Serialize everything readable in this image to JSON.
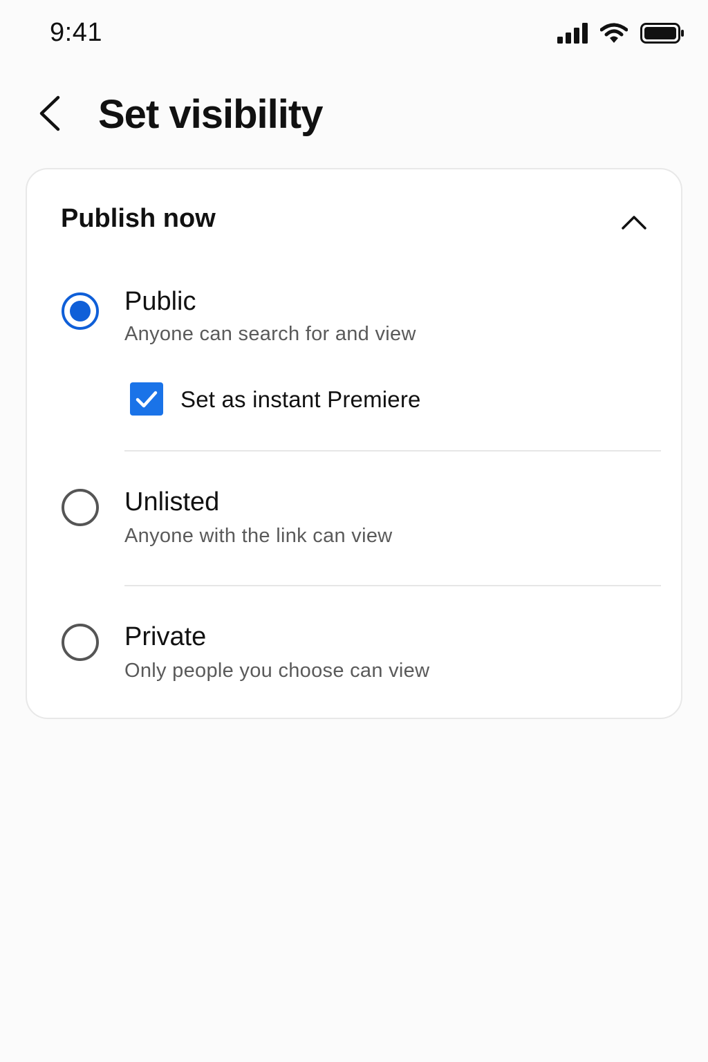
{
  "status_bar": {
    "time": "9:41",
    "icons": [
      "signal-icon",
      "wifi-icon",
      "battery-icon"
    ]
  },
  "header": {
    "back_icon": "chevron-left-icon",
    "title": "Set visibility"
  },
  "card": {
    "title": "Publish now",
    "collapse_icon": "chevron-up-icon",
    "options": [
      {
        "label": "Public",
        "description": "Anyone can search for and view",
        "selected": true
      },
      {
        "label": "Unlisted",
        "description": "Anyone with the link can view",
        "selected": false
      },
      {
        "label": "Private",
        "description": "Only people you choose can view",
        "selected": false
      }
    ],
    "premiere_checkbox": {
      "label": "Set as instant Premiere",
      "checked": true
    }
  },
  "colors": {
    "accent": "#0f5fd8",
    "checkbox": "#1a73e8",
    "background": "#fbfbfb",
    "card": "#ffffff"
  }
}
